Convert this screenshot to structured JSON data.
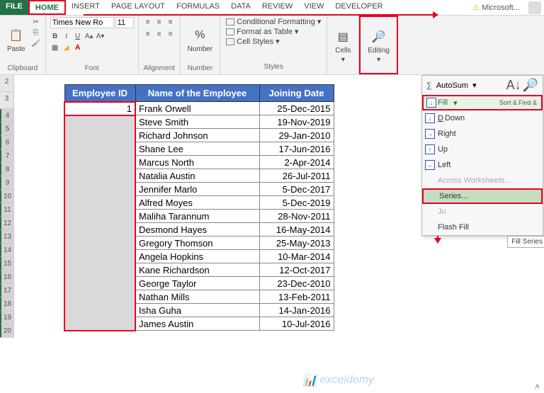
{
  "menubar": {
    "file": "FILE",
    "home": "HOME",
    "insert": "INSERT",
    "page": "PAGE LAYOUT",
    "formulas": "FORMULAS",
    "data": "DATA",
    "review": "REVIEW",
    "view": "VIEW",
    "dev": "DEVELOPER",
    "ms": "Microsoft..."
  },
  "ribbon": {
    "clipboard": {
      "paste": "Paste",
      "label": "Clipboard"
    },
    "font": {
      "name": "Times New Ro",
      "size": "11",
      "label": "Font"
    },
    "alignment": {
      "label": "Alignment"
    },
    "number": {
      "btn": "Number",
      "label": "Number"
    },
    "styles": {
      "cond": "Conditional Formatting",
      "fmt": "Format as Table",
      "cell": "Cell Styles",
      "label": "Styles"
    },
    "cells": {
      "btn": "Cells",
      "label": ""
    },
    "editing": {
      "btn": "Editing",
      "label": ""
    }
  },
  "row_headers": [
    "2",
    "3",
    "4",
    "5",
    "6",
    "7",
    "8",
    "9",
    "10",
    "11",
    "12",
    "13",
    "14",
    "15",
    "16",
    "17",
    "18",
    "19",
    "20"
  ],
  "table": {
    "headers": {
      "id": "Employee ID",
      "name": "Name of the Employee",
      "date": "Joining Date"
    },
    "rows": [
      {
        "id": "1",
        "name": "Frank Orwell",
        "date": "25-Dec-2015"
      },
      {
        "id": "",
        "name": "Steve Smith",
        "date": "19-Nov-2019"
      },
      {
        "id": "",
        "name": "Richard Johnson",
        "date": "29-Jan-2010"
      },
      {
        "id": "",
        "name": "Shane Lee",
        "date": "17-Jun-2016"
      },
      {
        "id": "",
        "name": "Marcus North",
        "date": "2-Apr-2014"
      },
      {
        "id": "",
        "name": "Natalia Austin",
        "date": "26-Jul-2011"
      },
      {
        "id": "",
        "name": "Jennifer Marlo",
        "date": "5-Dec-2017"
      },
      {
        "id": "",
        "name": "Alfred Moyes",
        "date": "5-Dec-2019"
      },
      {
        "id": "",
        "name": "Maliha Tarannum",
        "date": "28-Nov-2011"
      },
      {
        "id": "",
        "name": "Desmond Hayes",
        "date": "16-May-2014"
      },
      {
        "id": "",
        "name": "Gregory Thomson",
        "date": "25-May-2013"
      },
      {
        "id": "",
        "name": "Angela Hopkins",
        "date": "10-Mar-2014"
      },
      {
        "id": "",
        "name": "Kane Richardson",
        "date": "12-Oct-2017"
      },
      {
        "id": "",
        "name": "George Taylor",
        "date": "23-Dec-2010"
      },
      {
        "id": "",
        "name": "Nathan Mills",
        "date": "13-Feb-2011"
      },
      {
        "id": "",
        "name": "Isha Guha",
        "date": "14-Jan-2016"
      },
      {
        "id": "",
        "name": "James Austin",
        "date": "10-Jul-2016"
      }
    ]
  },
  "dropdown": {
    "autosum": "AutoSum",
    "fill": "Fill",
    "down": "Down",
    "right": "Right",
    "up": "Up",
    "left": "Left",
    "across": "Across Worksheets...",
    "series": "Series...",
    "justify": "Ju",
    "flash": "Flash Fill",
    "tooltip": "Fill Series",
    "sort": "Sort &",
    "find": "Find &"
  },
  "watermark": "exceldemy"
}
